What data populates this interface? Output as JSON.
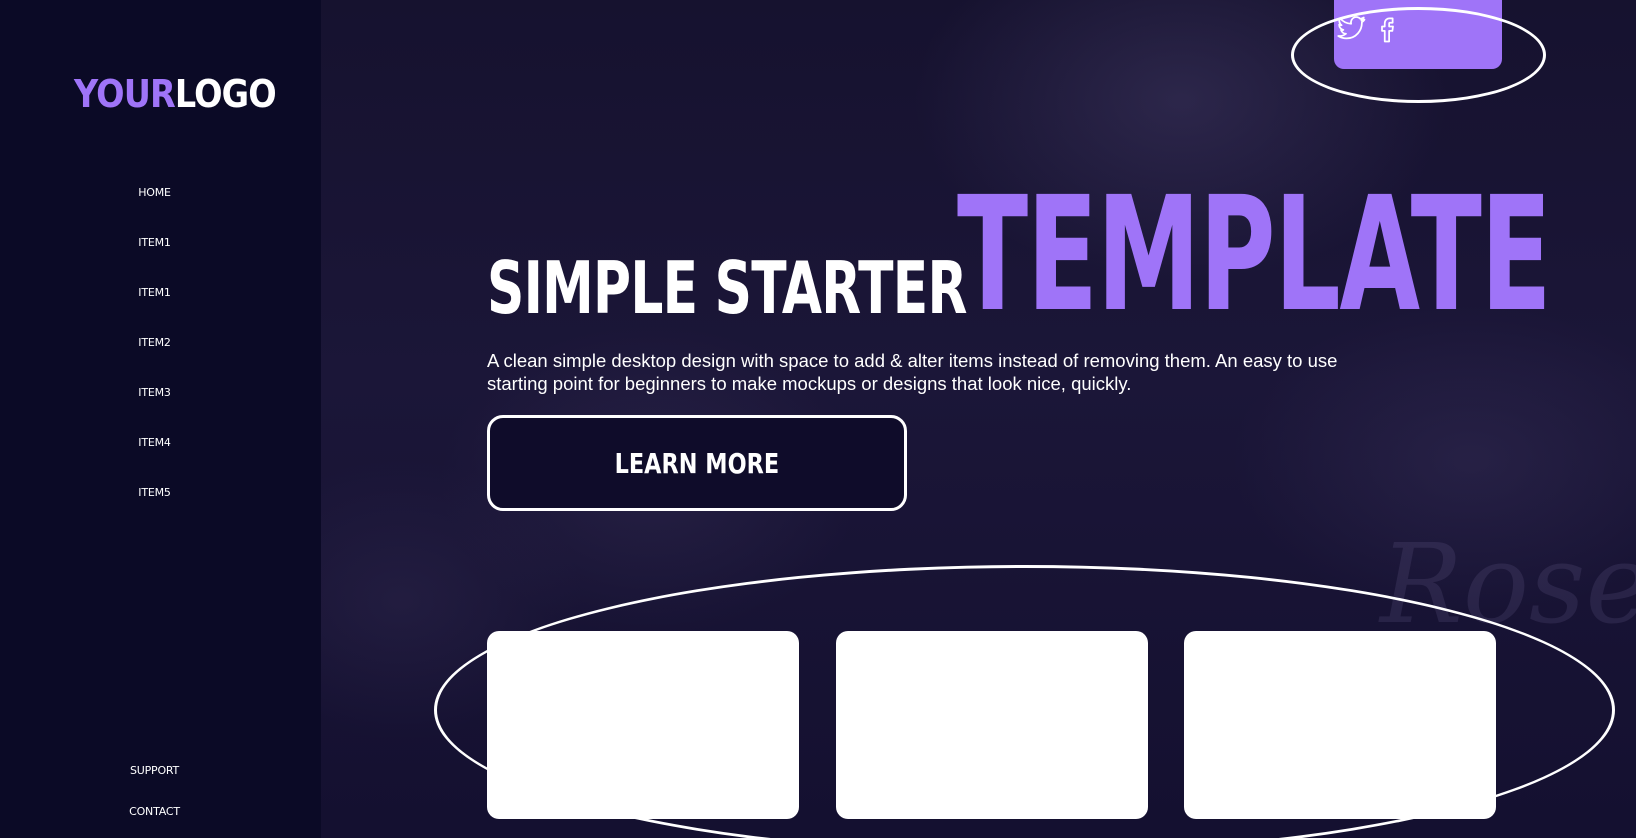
{
  "logo": {
    "accent": "YOUR",
    "main": "LOGO"
  },
  "nav": {
    "items": [
      "HOME",
      "ITEM1",
      "ITEM1",
      "ITEM2",
      "ITEM3",
      "ITEM4",
      "ITEM5"
    ],
    "footer_items": [
      "SUPPORT",
      "CONTACT"
    ]
  },
  "social": {
    "icons": [
      "twitter-icon",
      "facebook-icon"
    ]
  },
  "hero": {
    "headline_small": "SIMPLE STARTER",
    "headline_big": "TEMPLATE",
    "description": "A clean simple desktop design with space to add & alter items instead of removing them. An easy to use starting point for beginners to make mockups or designs that look nice, quickly.",
    "cta_label": "LEARN MORE",
    "background_script": "Rose"
  },
  "cards": {
    "count": 3
  },
  "colors": {
    "accent": "#9f74f8",
    "sidebar": "#0b0a26",
    "background": "#100d2c",
    "card": "#ffffff"
  }
}
